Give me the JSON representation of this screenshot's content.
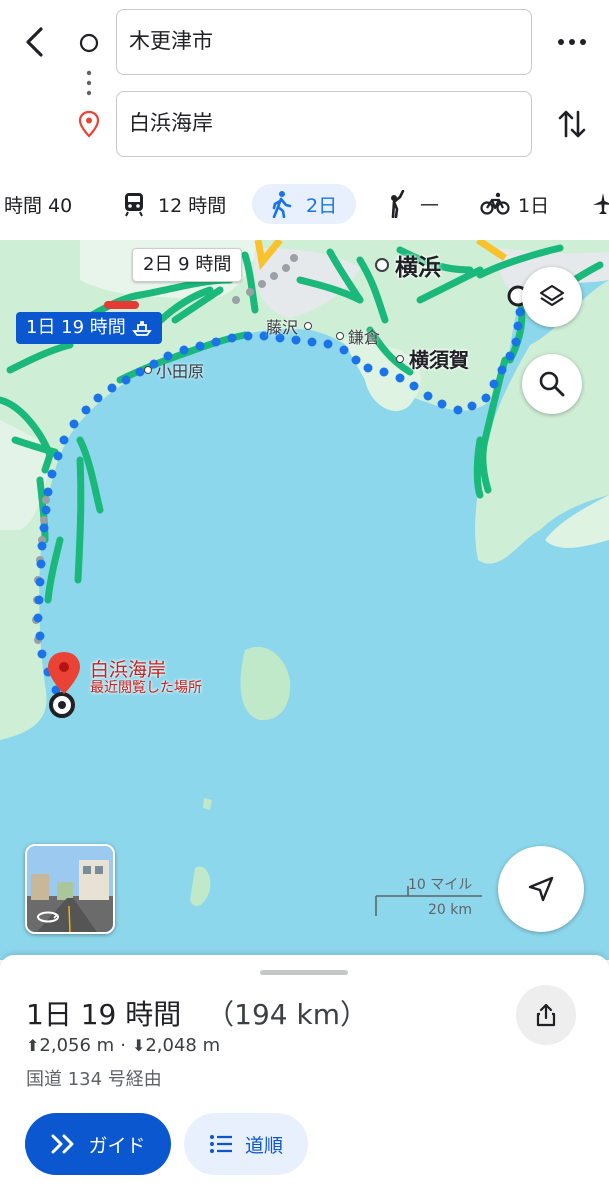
{
  "route": {
    "origin": "木更津市",
    "destination": "白浜海岸"
  },
  "modes": [
    {
      "label": "時間 40",
      "icon": "car-icon"
    },
    {
      "label": "12 時間",
      "icon": "train-icon"
    },
    {
      "label": "2日",
      "icon": "walk-icon",
      "selected": true
    },
    {
      "label": "—",
      "icon": "hail-icon"
    },
    {
      "label": "1日",
      "icon": "bicycle-icon"
    },
    {
      "label": "",
      "icon": "flight-icon"
    }
  ],
  "map": {
    "route_label_alt": "2日 9 時間",
    "route_label_main": "1日 19 時間",
    "places": [
      "横浜",
      "藤沢",
      "鎌倉",
      "横須賀",
      "小田原"
    ],
    "destination_name": "白浜海岸",
    "destination_note": "最近閲覧した場所",
    "scale_top": "10 マイル",
    "scale_bottom": "20 km",
    "colors": {
      "water": "#8dd7ec",
      "land": "#cfeed6",
      "route": "#1a73e8",
      "traffic": "#1ab87a"
    }
  },
  "summary": {
    "duration": "1日 19 時間",
    "distance": "（194 km）",
    "ascent": "2,056 m",
    "separator": "·",
    "descent": "2,048 m",
    "via": "国道 134 号経由",
    "guide_button": "ガイド",
    "steps_button": "道順"
  }
}
